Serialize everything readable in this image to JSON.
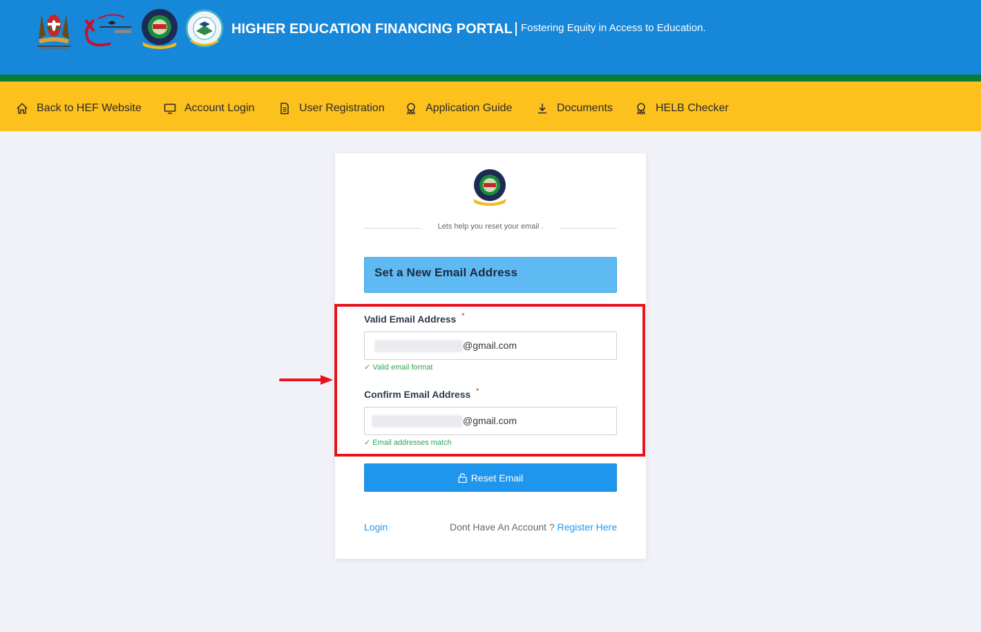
{
  "header": {
    "title": "HIGHER EDUCATION FINANCING PORTAL",
    "tagline": "Fostering Equity in Access to Education."
  },
  "nav": {
    "items": [
      {
        "label": "Back to HEF Website",
        "icon": "home-icon"
      },
      {
        "label": "Account Login",
        "icon": "monitor-icon"
      },
      {
        "label": "User Registration",
        "icon": "document-icon"
      },
      {
        "label": "Application Guide",
        "icon": "award-icon"
      },
      {
        "label": "Documents",
        "icon": "download-icon"
      },
      {
        "label": "HELB Checker",
        "icon": "award-icon"
      }
    ]
  },
  "card": {
    "divider_text": "Lets help you reset your email .",
    "heading": "Set a New Email Address",
    "email_label": "Valid Email Address",
    "email_domain": "@gmail.com",
    "email_hint": "✓ Valid email format",
    "confirm_label": "Confirm Email Address",
    "confirm_domain": "@gmail.com",
    "confirm_hint": "✓ Email addresses match",
    "required_mark": "*",
    "reset_button": "Reset Email",
    "login_link": "Login",
    "no_account_text": "Dont Have An Account ?",
    "register_link": "Register Here"
  },
  "colors": {
    "header_blue": "#1687d9",
    "nav_yellow": "#fdc11d",
    "stripe_green": "#0a7b32",
    "button_blue": "#1e96ee",
    "highlight_red": "#e8121b",
    "success_green": "#2ea34e"
  }
}
